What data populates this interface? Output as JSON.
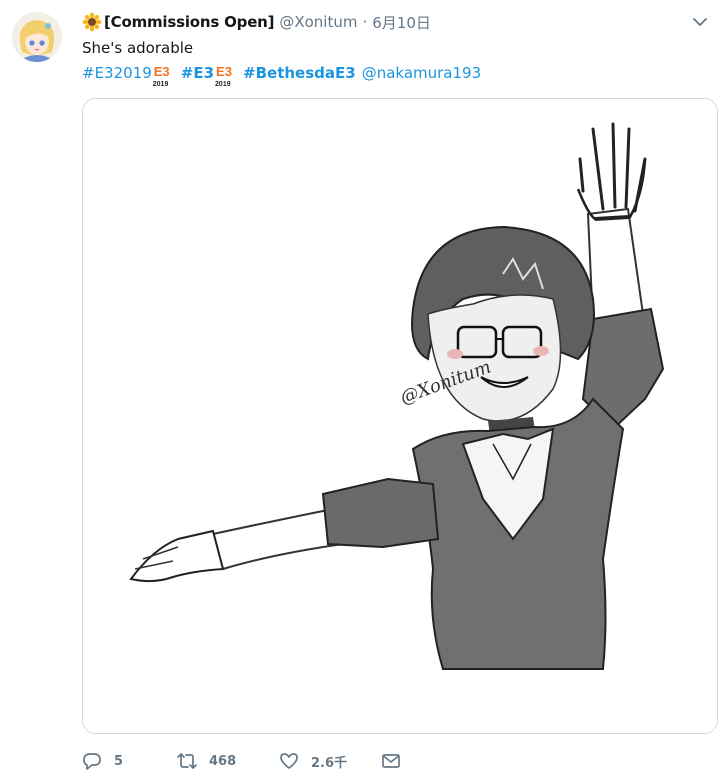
{
  "tweet": {
    "display_name": "[Commissions Open]",
    "handle": "@Xonitum",
    "separator": "·",
    "date": "6月10日",
    "text": "She's adorable",
    "hashtags": [
      {
        "label": "#E32019",
        "badge": true
      },
      {
        "label": "#E3",
        "badge": true
      },
      {
        "label": "#BethesdaE3",
        "badge": false
      }
    ],
    "badge": {
      "brand": "E3",
      "year": "2019"
    },
    "mention": "@nakamura193",
    "image_signature": "@Xonitum"
  },
  "actions": {
    "replies": "5",
    "retweets": "468",
    "likes": "2.6千"
  },
  "colors": {
    "link": "#1b95e0",
    "muted": "#657786",
    "border": "#ccd6dd",
    "badge_orange": "#f37021"
  },
  "icons": [
    "sunflower-icon",
    "chevron-down-icon",
    "reply-icon",
    "retweet-icon",
    "like-icon",
    "dm-icon"
  ]
}
